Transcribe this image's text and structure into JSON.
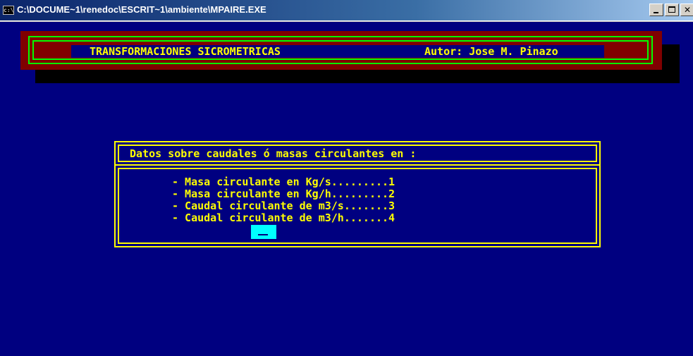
{
  "window": {
    "title": "C:\\DOCUME~1\\renedoc\\ESCRIT~1\\ambiente\\MPAIRE.EXE",
    "app_icon": "console-icon",
    "app_icon_text": "c:\\",
    "buttons": {
      "minimize": "minimize-icon",
      "maximize": "maximize-icon",
      "close": "close-icon"
    }
  },
  "banner": {
    "title": "TRANSFORMACIONES SICROMETRICAS",
    "author": "Autor: Jose M. Pinazo"
  },
  "dialog": {
    "header": "Datos sobre caudales ó masas circulantes en :",
    "options": [
      {
        "text": "- Masa circulante en Kg/s.........1"
      },
      {
        "text": "- Masa circulante en Kg/h.........2"
      },
      {
        "text": "- Caudal circulante de m3/s.......3"
      },
      {
        "text": "- Caudal circulante de m3/h.......4"
      }
    ],
    "input_value": ""
  },
  "colors": {
    "console_background": "#000080",
    "banner_background": "#800000",
    "banner_frame": "#00ff00",
    "text": "#ffff00",
    "cursor": "#00ffff"
  }
}
